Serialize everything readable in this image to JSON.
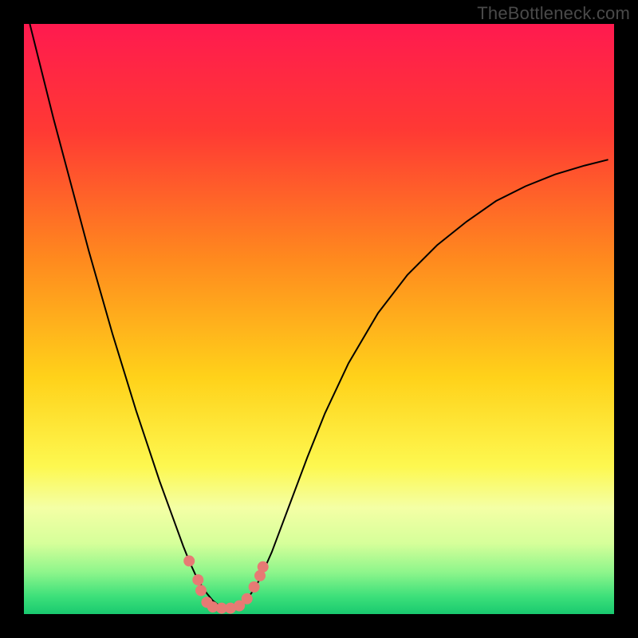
{
  "watermark": "TheBottleneck.com",
  "chart_data": {
    "type": "line",
    "title": "",
    "xlabel": "",
    "ylabel": "",
    "xlim": [
      0,
      1
    ],
    "ylim": [
      0,
      1
    ],
    "background_gradient": {
      "stops": [
        {
          "offset": 0.0,
          "color": "#ff1a4f"
        },
        {
          "offset": 0.18,
          "color": "#ff3934"
        },
        {
          "offset": 0.4,
          "color": "#ff8a1e"
        },
        {
          "offset": 0.6,
          "color": "#ffd21a"
        },
        {
          "offset": 0.75,
          "color": "#fdf850"
        },
        {
          "offset": 0.82,
          "color": "#f4ffa5"
        },
        {
          "offset": 0.88,
          "color": "#d6ff9a"
        },
        {
          "offset": 0.93,
          "color": "#8cf58b"
        },
        {
          "offset": 0.97,
          "color": "#3de07a"
        },
        {
          "offset": 1.0,
          "color": "#19c96f"
        }
      ]
    },
    "series": [
      {
        "name": "bottleneck-curve",
        "x": [
          0.01,
          0.03,
          0.05,
          0.07,
          0.09,
          0.11,
          0.13,
          0.15,
          0.17,
          0.19,
          0.21,
          0.23,
          0.25,
          0.27,
          0.28,
          0.29,
          0.3,
          0.31,
          0.32,
          0.33,
          0.34,
          0.35,
          0.36,
          0.37,
          0.38,
          0.39,
          0.4,
          0.42,
          0.45,
          0.48,
          0.51,
          0.55,
          0.6,
          0.65,
          0.7,
          0.75,
          0.8,
          0.85,
          0.9,
          0.95,
          0.99
        ],
        "y": [
          1.0,
          0.92,
          0.84,
          0.765,
          0.69,
          0.615,
          0.545,
          0.475,
          0.41,
          0.345,
          0.285,
          0.225,
          0.17,
          0.115,
          0.09,
          0.068,
          0.05,
          0.035,
          0.023,
          0.015,
          0.01,
          0.01,
          0.012,
          0.018,
          0.028,
          0.042,
          0.06,
          0.105,
          0.185,
          0.265,
          0.34,
          0.425,
          0.51,
          0.575,
          0.625,
          0.665,
          0.7,
          0.725,
          0.745,
          0.76,
          0.77
        ]
      }
    ],
    "markers": {
      "name": "highlight-dots",
      "color": "#e77a74",
      "points": [
        {
          "x": 0.28,
          "y": 0.09
        },
        {
          "x": 0.295,
          "y": 0.058
        },
        {
          "x": 0.3,
          "y": 0.04
        },
        {
          "x": 0.31,
          "y": 0.02
        },
        {
          "x": 0.32,
          "y": 0.012
        },
        {
          "x": 0.335,
          "y": 0.01
        },
        {
          "x": 0.35,
          "y": 0.01
        },
        {
          "x": 0.365,
          "y": 0.014
        },
        {
          "x": 0.378,
          "y": 0.026
        },
        {
          "x": 0.39,
          "y": 0.046
        },
        {
          "x": 0.4,
          "y": 0.065
        },
        {
          "x": 0.405,
          "y": 0.08
        }
      ]
    }
  }
}
